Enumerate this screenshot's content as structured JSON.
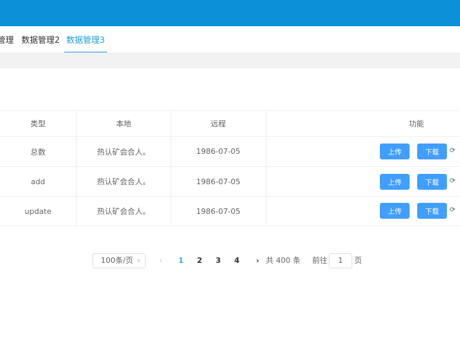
{
  "colors": {
    "header": "#0a91d6",
    "accent": "#1a9dde",
    "button": "#409eff"
  },
  "tabs": [
    {
      "label": "管理",
      "active": false
    },
    {
      "label": "数据管理2",
      "active": false
    },
    {
      "label": "数据管理3",
      "active": true
    }
  ],
  "table": {
    "headers": {
      "type": "类型",
      "local": "本地",
      "remote": "远程",
      "actions": "功能"
    },
    "rows": [
      {
        "type": "总数",
        "local": "热认矿会合人。",
        "remote": "1986-07-05"
      },
      {
        "type": "add",
        "local": "热认矿会合人。",
        "remote": "1986-07-05"
      },
      {
        "type": "update",
        "local": "热认矿会合人。",
        "remote": "1986-07-05"
      }
    ],
    "actions": {
      "upload": "上传",
      "download": "下载",
      "refresh_icon": "refresh-icon"
    }
  },
  "pagination": {
    "page_size": "100条/页",
    "pages": [
      "1",
      "2",
      "3",
      "4"
    ],
    "current": "1",
    "prev": "‹",
    "next": "›",
    "total": "共 400 条",
    "goto_label": "前往",
    "goto_value": "1",
    "goto_suffix": "页"
  }
}
